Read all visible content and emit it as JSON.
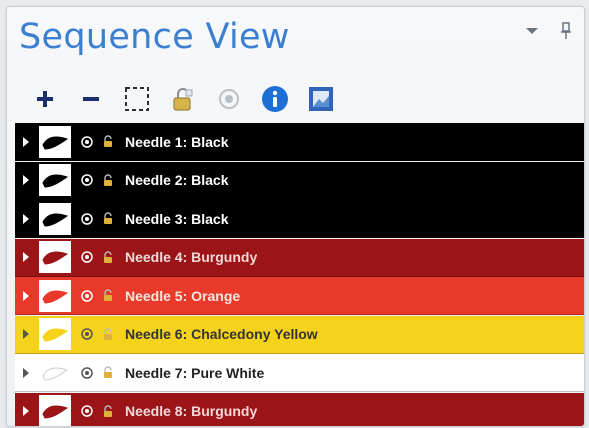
{
  "panel": {
    "title": "Sequence View"
  },
  "colors": {
    "title": "#3a7fd0",
    "accent_blue": "#1e6fd4"
  },
  "toolbar": {
    "items": [
      {
        "icon": "plus-icon"
      },
      {
        "icon": "minus-icon"
      },
      {
        "icon": "select-marquee-icon"
      },
      {
        "icon": "lock-multiple-icon"
      },
      {
        "icon": "visibility-icon"
      },
      {
        "icon": "info-icon"
      },
      {
        "icon": "image-view-icon"
      }
    ]
  },
  "needles": [
    {
      "label": "Needle 1: Black",
      "bg": "#000000",
      "text": "#ffffff",
      "thumb_color": "#000000",
      "icon_color": "#ffffff"
    },
    {
      "label": "Needle 2: Black",
      "bg": "#000000",
      "text": "#ffffff",
      "thumb_color": "#000000",
      "icon_color": "#ffffff"
    },
    {
      "label": "Needle 3: Black",
      "bg": "#000000",
      "text": "#ffffff",
      "thumb_color": "#000000",
      "icon_color": "#ffffff"
    },
    {
      "label": "Needle 4: Burgundy",
      "bg": "#9b1418",
      "text": "#f4d9d9",
      "thumb_color": "#9b1418",
      "icon_color": "#ffffff"
    },
    {
      "label": "Needle 5: Orange",
      "bg": "#e8392a",
      "text": "#ffe6dc",
      "thumb_color": "#e8392a",
      "icon_color": "#ffffff"
    },
    {
      "label": "Needle 6: Chalcedony Yellow",
      "bg": "#f5d31a",
      "text": "#333333",
      "thumb_color": "#f5d31a",
      "icon_color": "#555555"
    },
    {
      "label": "Needle 7: Pure White",
      "bg": "#ffffff",
      "text": "#222222",
      "thumb_color": "#ffffff",
      "icon_color": "#555555"
    },
    {
      "label": "Needle 8: Burgundy",
      "bg": "#9b1418",
      "text": "#f4d9d9",
      "thumb_color": "#9b1418",
      "icon_color": "#ffffff"
    }
  ]
}
